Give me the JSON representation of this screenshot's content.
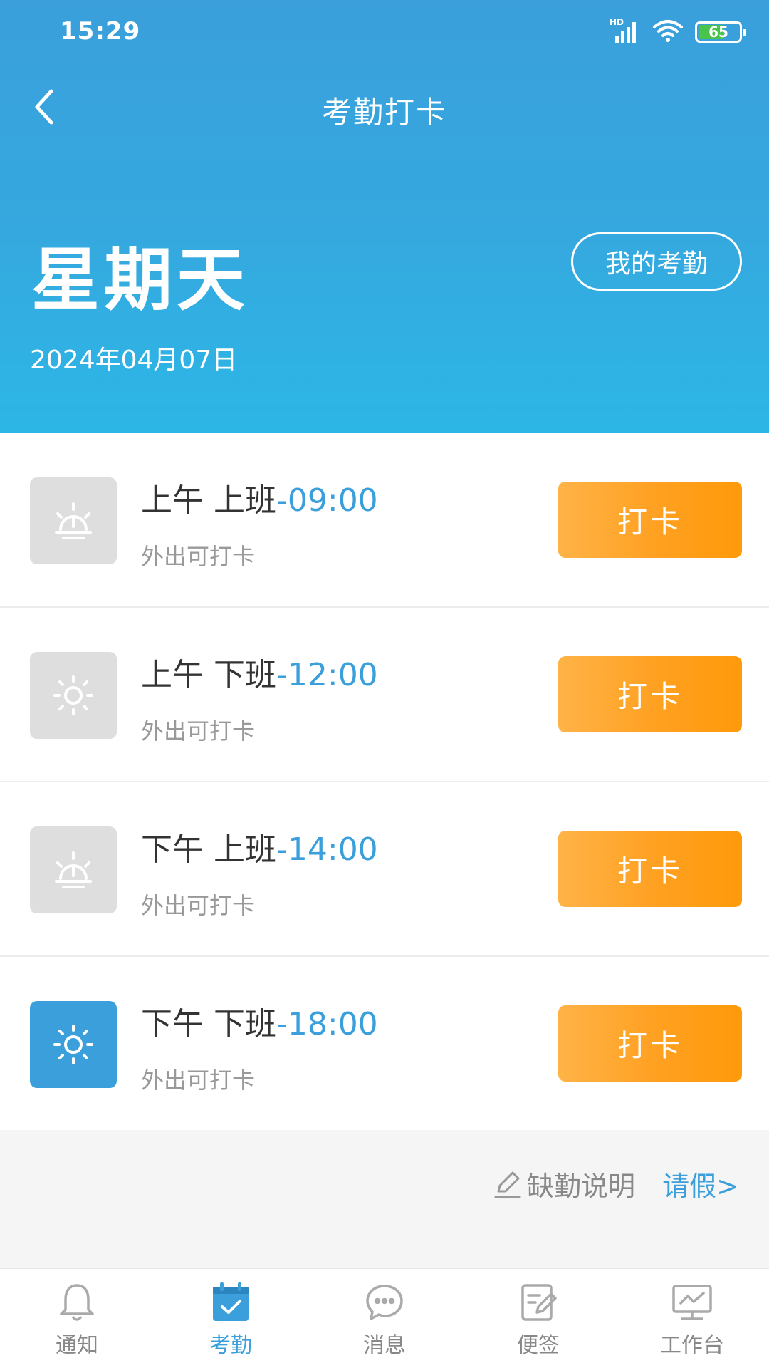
{
  "status_bar": {
    "time": "15:29",
    "network": "HD",
    "battery": "65",
    "battery_level": 0.65
  },
  "nav": {
    "title": "考勤打卡"
  },
  "summary": {
    "weekday": "星期天",
    "date": "2024年04月07日",
    "my_attendance_label": "我的考勤"
  },
  "punch_rows": [
    {
      "period": "上午 上班",
      "time": "-09:00",
      "note": "外出可打卡",
      "button": "打卡",
      "icon": "sunrise-icon"
    },
    {
      "period": "上午 下班",
      "time": "-12:00",
      "note": "外出可打卡",
      "button": "打卡",
      "icon": "sun-icon"
    },
    {
      "period": "下午 上班",
      "time": "-14:00",
      "note": "外出可打卡",
      "button": "打卡",
      "icon": "sunrise-icon"
    },
    {
      "period": "下午 下班",
      "time": "-18:00",
      "note": "外出可打卡",
      "button": "打卡",
      "icon": "sun-icon"
    }
  ],
  "footer": {
    "absence_label": "缺勤说明",
    "leave_label": "请假>"
  },
  "tabs": [
    {
      "label": "通知",
      "icon": "bell-icon"
    },
    {
      "label": "考勤",
      "icon": "calendar-check-icon",
      "active": true
    },
    {
      "label": "消息",
      "icon": "chat-bubble-icon"
    },
    {
      "label": "便签",
      "icon": "note-edit-icon"
    },
    {
      "label": "工作台",
      "icon": "monitor-chart-icon"
    }
  ],
  "colors": {
    "primary": "#3a9fdb",
    "accent": "#ffa020",
    "inactive_icon_bg": "#dedede"
  }
}
